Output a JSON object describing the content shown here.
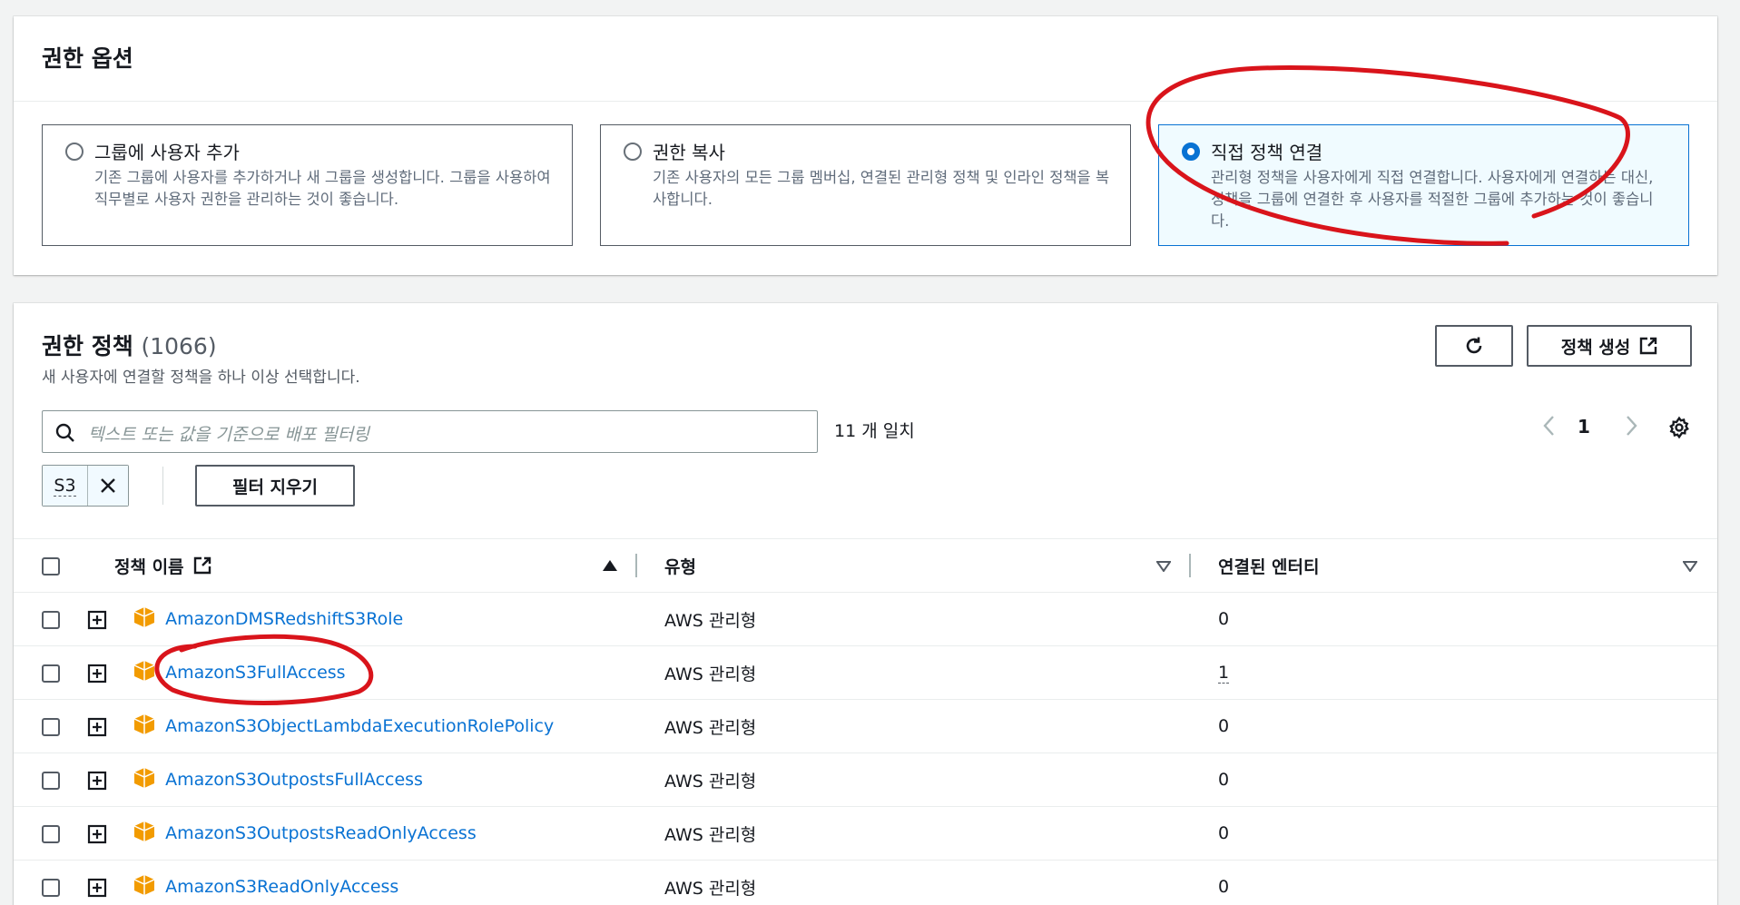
{
  "options_card": {
    "title": "권한 옵션",
    "options": [
      {
        "title": "그룹에 사용자 추가",
        "desc": "기존 그룹에 사용자를 추가하거나 새 그룹을 생성합니다. 그룹을 사용하여 직무별로 사용자 권한을 관리하는 것이 좋습니다.",
        "selected": false
      },
      {
        "title": "권한 복사",
        "desc": "기존 사용자의 모든 그룹 멤버십, 연결된 관리형 정책 및 인라인 정책을 복사합니다.",
        "selected": false
      },
      {
        "title": "직접 정책 연결",
        "desc": "관리형 정책을 사용자에게 직접 연결합니다. 사용자에게 연결하는 대신, 정책을 그룹에 연결한 후 사용자를 적절한 그룹에 추가하는 것이 좋습니다.",
        "selected": true
      }
    ]
  },
  "policies_card": {
    "title": "권한 정책",
    "count": "(1066)",
    "subtitle": "새 사용자에 연결할 정책을 하나 이상 선택합니다.",
    "refresh_icon": "refresh-icon",
    "create_button": "정책 생성",
    "search_placeholder": "텍스트 또는 값을 기준으로 배포 필터링",
    "match_text": "11 개 일치",
    "page": "1",
    "filter_token": "S3",
    "clear_filter": "필터 지우기",
    "columns": {
      "name": "정책 이름",
      "type": "유형",
      "entities": "연결된 엔터티"
    },
    "rows": [
      {
        "name": "AmazonDMSRedshiftS3Role",
        "type": "AWS 관리형",
        "entities": "0"
      },
      {
        "name": "AmazonS3FullAccess",
        "type": "AWS 관리형",
        "entities": "1"
      },
      {
        "name": "AmazonS3ObjectLambdaExecutionRolePolicy",
        "type": "AWS 관리형",
        "entities": "0"
      },
      {
        "name": "AmazonS3OutpostsFullAccess",
        "type": "AWS 관리형",
        "entities": "0"
      },
      {
        "name": "AmazonS3OutpostsReadOnlyAccess",
        "type": "AWS 관리형",
        "entities": "0"
      },
      {
        "name": "AmazonS3ReadOnlyAccess",
        "type": "AWS 관리형",
        "entities": "0"
      }
    ]
  },
  "colors": {
    "accent": "#0972d3",
    "annotation": "#d9141b",
    "package": "#f29b00"
  }
}
